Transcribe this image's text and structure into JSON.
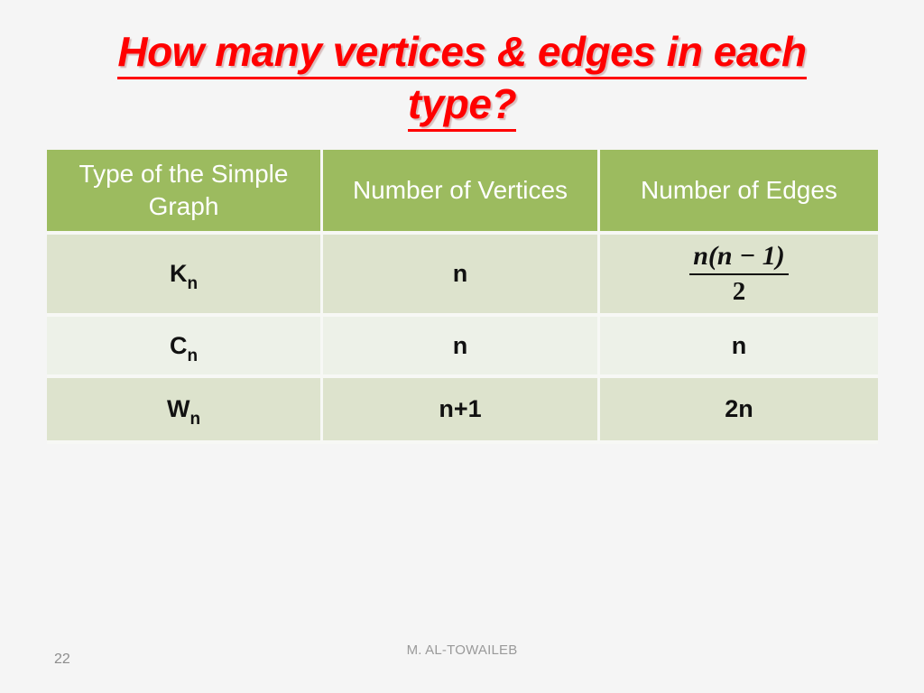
{
  "slide": {
    "title_lines": [
      "How many vertices & edges in each",
      "type?"
    ],
    "title_color": "#FF0000",
    "background_color": "#F5F5F5"
  },
  "table": {
    "header_bg": "#9CBB5F",
    "header_text_color": "#FFFFFF",
    "row_dark_bg": "#DDE3CD",
    "row_light_bg": "#EDF1E8",
    "columns": [
      "Type of the Simple Graph",
      "Number of Vertices",
      "Number of Edges"
    ],
    "rows": [
      {
        "graph_symbol": "K",
        "graph_subscript": "n",
        "vertices": "n",
        "edges_numerator_var": "n",
        "edges_numerator_rest": "(n − 1)",
        "edges_denominator": "2",
        "edges_plain": "n(n − 1) / 2"
      },
      {
        "graph_symbol": "C",
        "graph_subscript": "n",
        "vertices": "n",
        "edges_plain": "n"
      },
      {
        "graph_symbol": "W",
        "graph_subscript": "n",
        "vertices": "n+1",
        "edges_plain": "2n"
      }
    ]
  },
  "footer": {
    "slide_number": "22",
    "author": "M. AL-TOWAILEB"
  }
}
